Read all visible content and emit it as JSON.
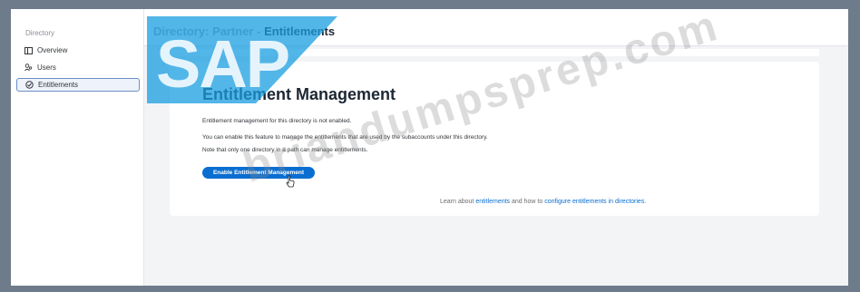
{
  "sidebar": {
    "header": "Directory",
    "items": [
      {
        "label": "Overview",
        "icon": "overview-icon"
      },
      {
        "label": "Users",
        "icon": "users-icon"
      },
      {
        "label": "Entitlements",
        "icon": "entitlements-icon",
        "selected": true
      }
    ]
  },
  "header": {
    "breadcrumb_prefix": "Directory: Partner - ",
    "title": "Entitlements"
  },
  "card": {
    "title": "Entitlement Management",
    "line1": "Entitlement management for this directory is not enabled.",
    "line2": "You can enable this feature to manage the entitlements that are used by the subaccounts under this directory.",
    "line3": "Note that only one directory in a path can manage entitlements.",
    "button_label": "Enable Entitlement Management",
    "learn_prefix": "Learn about ",
    "learn_link1": "entitlements",
    "learn_middle": " and how to ",
    "learn_link2": "configure entitlements in directories",
    "learn_suffix": "."
  },
  "logo": {
    "text": "SAP",
    "color": "#1a9ee0"
  },
  "watermark": "briandumpsprep.com",
  "colors": {
    "accent": "#0a6ed1",
    "frame": "#6e7b8a"
  }
}
